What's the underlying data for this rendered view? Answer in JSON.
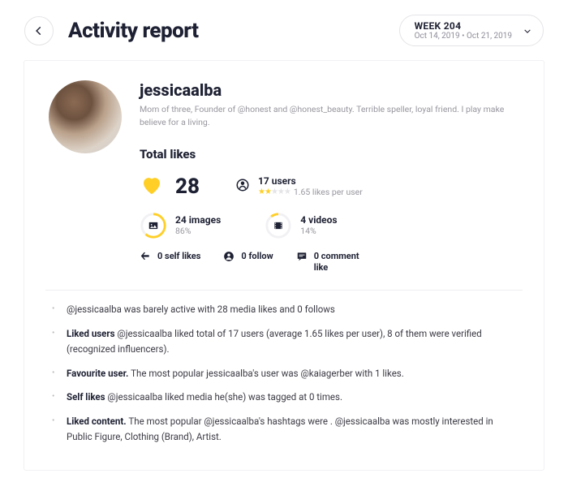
{
  "header": {
    "title": "Activity report",
    "week_label": "WEEK 204",
    "week_range": "Oct 14, 2019  •  Oct 21, 2019"
  },
  "profile": {
    "username": "jessicaalba",
    "bio": "Mom of three, Founder of @honest and @honest_beauty. Terrible speller, loyal friend. I play make believe for a living."
  },
  "section": {
    "total_likes_title": "Total likes"
  },
  "stats": {
    "total_likes": "28",
    "users_count": "17 users",
    "likes_per_user": "1.65 likes per user",
    "images_count": "24 images",
    "images_pct": "86%",
    "videos_count": "4 videos",
    "videos_pct": "14%",
    "self_likes": "0 self likes",
    "follow": "0 follow",
    "comment_like": "0 comment like"
  },
  "bullets": [
    {
      "label": "",
      "text": "@jessicaalba was barely active with 28 media likes and 0 follows"
    },
    {
      "label": "Liked users ",
      "text": "@jessicaalba liked total of 17 users (average 1.65 likes per user), 8 of them were verified (recognized influencers)."
    },
    {
      "label": "Favourite user. ",
      "text": "The most popular jessicaalba's user was @kaiagerber with 1 likes."
    },
    {
      "label": "Self likes ",
      "text": "@jessicaalba liked media he(she) was tagged at 0 times."
    },
    {
      "label": "Liked content. ",
      "text": "The most popular @jessicaalba's hashtags were . @jessicaalba was mostly interested in Public Figure, Clothing (Brand), Artist."
    }
  ]
}
